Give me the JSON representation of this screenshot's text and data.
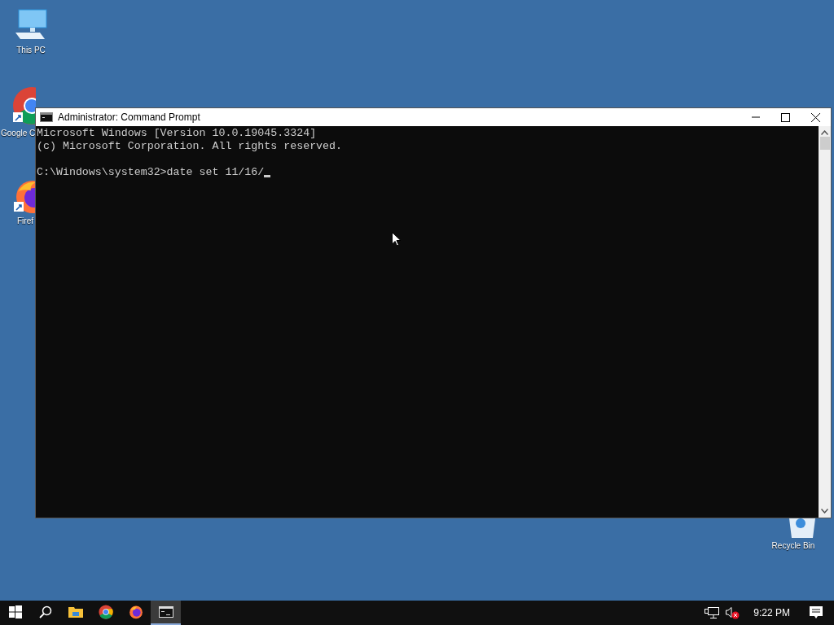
{
  "desktop_icons": [
    {
      "kind": "pc",
      "label": "This PC"
    },
    {
      "kind": "chrome",
      "label": "Google C"
    },
    {
      "kind": "firefox",
      "label": "Firef"
    },
    {
      "kind": "recycle",
      "label": "Recycle Bin"
    }
  ],
  "window": {
    "title": "Administrator: Command Prompt",
    "blocks": [
      [
        "Microsoft Windows [Version 10.0.19045.3324]",
        "(c) Microsoft Corporation. All rights reserved."
      ],
      [
        "C:\\Windows\\system32>date set 11/16/"
      ]
    ],
    "cursor": true
  },
  "taskbar": {
    "apps": [
      {
        "kind": "start",
        "selected": false
      },
      {
        "kind": "search",
        "selected": false
      },
      {
        "kind": "explorer",
        "selected": false
      },
      {
        "kind": "chrome",
        "selected": false
      },
      {
        "kind": "firefox",
        "selected": false
      },
      {
        "kind": "cmd",
        "selected": true
      }
    ],
    "clock": "9:22 PM"
  }
}
